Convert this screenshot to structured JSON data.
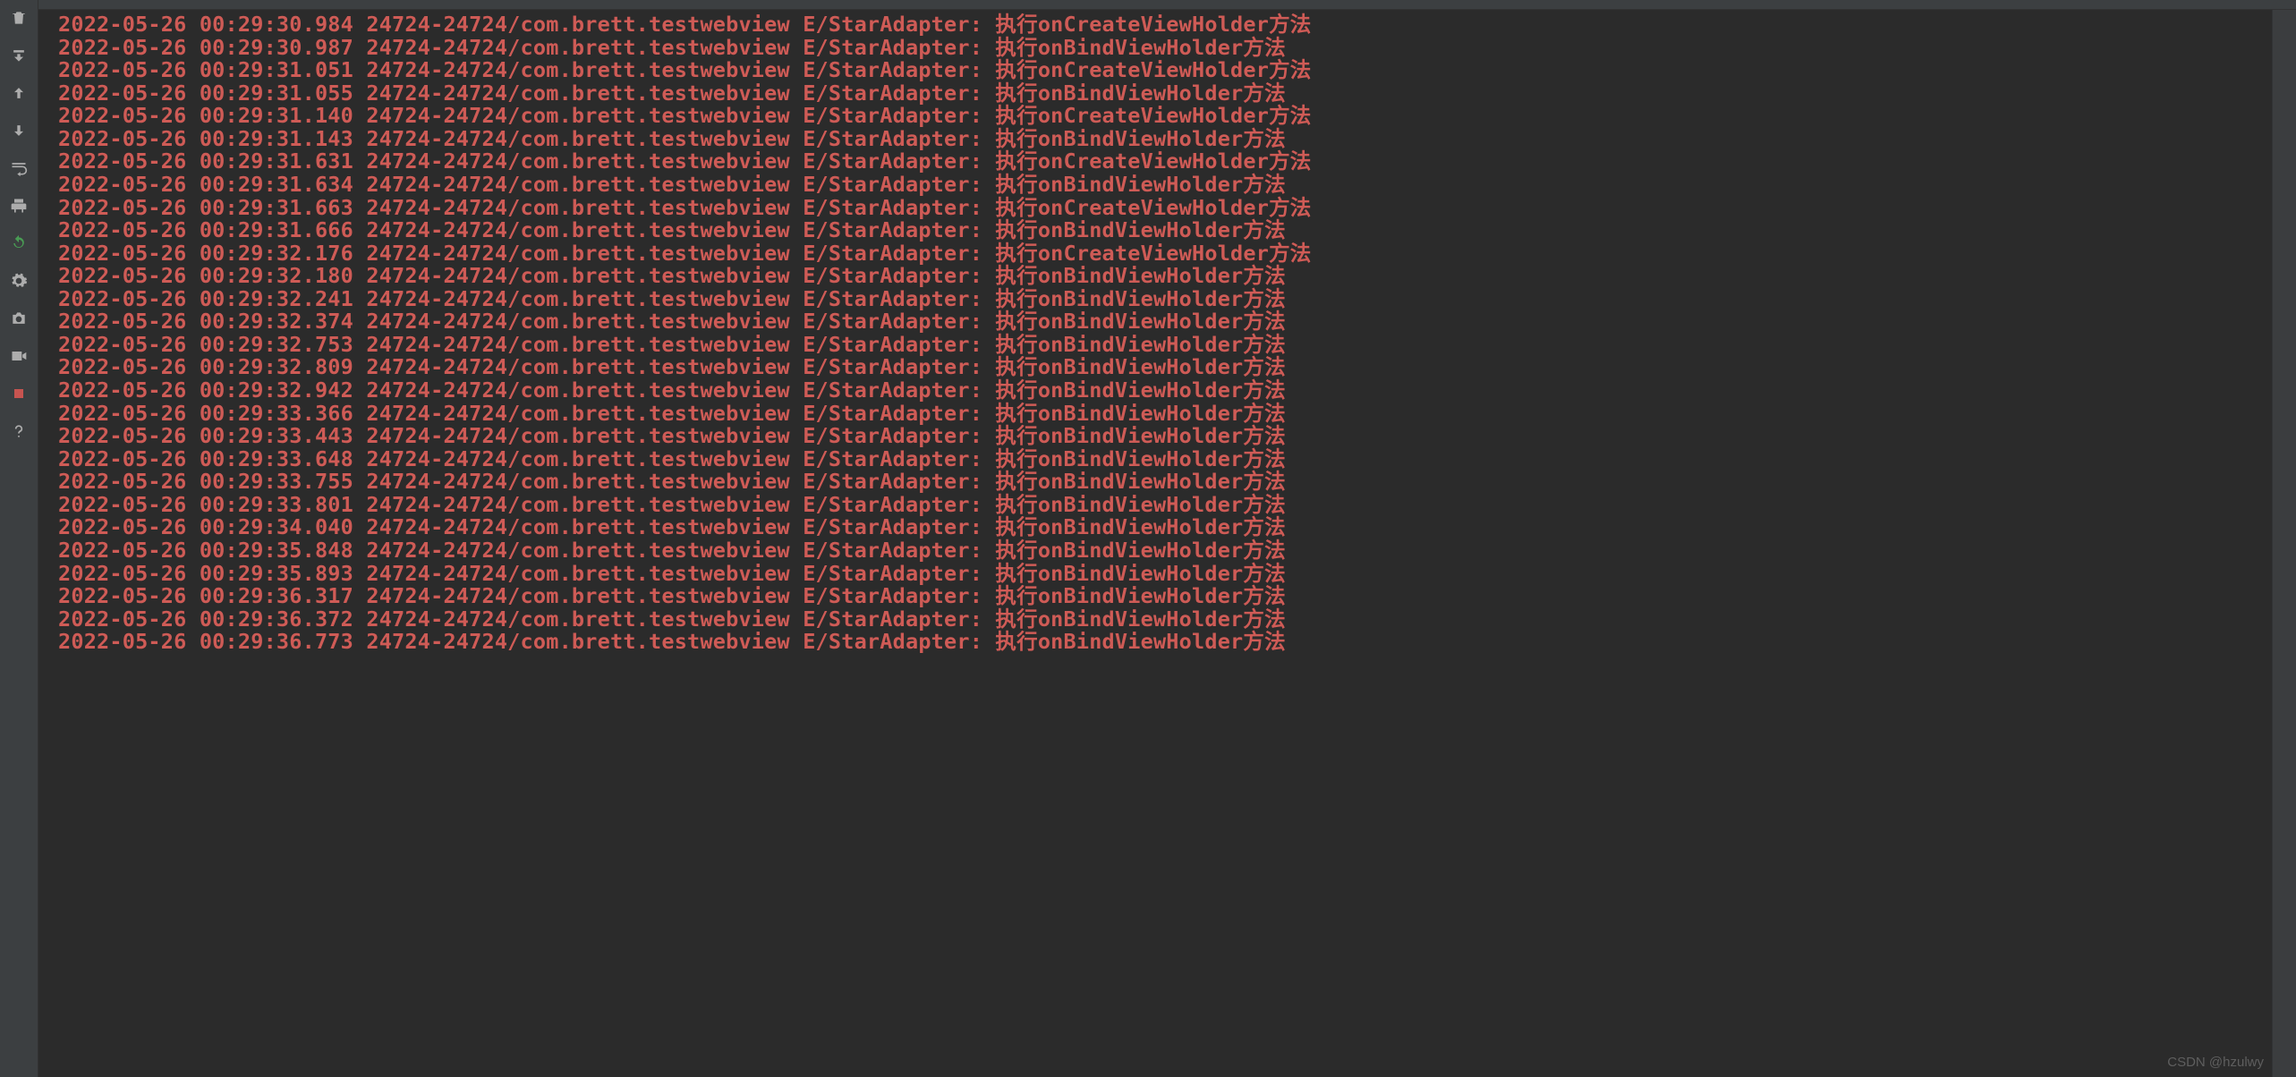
{
  "watermark": "CSDN @hzulwy",
  "gutter": {
    "items": [
      {
        "name": "trash-icon",
        "type": "trash",
        "interact": true,
        "color": ""
      },
      {
        "name": "scroll-end-icon",
        "type": "scroll-end",
        "interact": true,
        "color": ""
      },
      {
        "name": "arrow-up-icon",
        "type": "arrow-up",
        "interact": true,
        "color": ""
      },
      {
        "name": "arrow-down-icon",
        "type": "arrow-down",
        "interact": true,
        "color": ""
      },
      {
        "name": "softwrap-icon",
        "type": "softwrap",
        "interact": true,
        "color": ""
      },
      {
        "name": "printer-icon",
        "type": "printer",
        "interact": true,
        "color": ""
      },
      {
        "name": "restart-icon",
        "type": "restart",
        "interact": true,
        "color": "green"
      },
      {
        "name": "settings-icon",
        "type": "gear",
        "interact": true,
        "color": ""
      },
      {
        "name": "screenshot-icon",
        "type": "camera",
        "interact": true,
        "color": ""
      },
      {
        "name": "screen-record-icon",
        "type": "video",
        "interact": true,
        "color": ""
      },
      {
        "name": "stop-icon",
        "type": "stop",
        "interact": true,
        "color": "red"
      },
      {
        "name": "help-icon",
        "type": "help",
        "interact": true,
        "color": ""
      }
    ]
  },
  "log": {
    "date": "2022-05-26",
    "process": "24724-24724/com.brett.testwebview",
    "tag": "E/StarAdapter:",
    "lines": [
      {
        "time": "00:29:30.984",
        "msg": "执行onCreateViewHolder方法"
      },
      {
        "time": "00:29:30.987",
        "msg": "执行onBindViewHolder方法"
      },
      {
        "time": "00:29:31.051",
        "msg": "执行onCreateViewHolder方法"
      },
      {
        "time": "00:29:31.055",
        "msg": "执行onBindViewHolder方法"
      },
      {
        "time": "00:29:31.140",
        "msg": "执行onCreateViewHolder方法"
      },
      {
        "time": "00:29:31.143",
        "msg": "执行onBindViewHolder方法"
      },
      {
        "time": "00:29:31.631",
        "msg": "执行onCreateViewHolder方法"
      },
      {
        "time": "00:29:31.634",
        "msg": "执行onBindViewHolder方法"
      },
      {
        "time": "00:29:31.663",
        "msg": "执行onCreateViewHolder方法"
      },
      {
        "time": "00:29:31.666",
        "msg": "执行onBindViewHolder方法"
      },
      {
        "time": "00:29:32.176",
        "msg": "执行onCreateViewHolder方法"
      },
      {
        "time": "00:29:32.180",
        "msg": "执行onBindViewHolder方法"
      },
      {
        "time": "00:29:32.241",
        "msg": "执行onBindViewHolder方法"
      },
      {
        "time": "00:29:32.374",
        "msg": "执行onBindViewHolder方法"
      },
      {
        "time": "00:29:32.753",
        "msg": "执行onBindViewHolder方法"
      },
      {
        "time": "00:29:32.809",
        "msg": "执行onBindViewHolder方法"
      },
      {
        "time": "00:29:32.942",
        "msg": "执行onBindViewHolder方法"
      },
      {
        "time": "00:29:33.366",
        "msg": "执行onBindViewHolder方法"
      },
      {
        "time": "00:29:33.443",
        "msg": "执行onBindViewHolder方法"
      },
      {
        "time": "00:29:33.648",
        "msg": "执行onBindViewHolder方法"
      },
      {
        "time": "00:29:33.755",
        "msg": "执行onBindViewHolder方法"
      },
      {
        "time": "00:29:33.801",
        "msg": "执行onBindViewHolder方法"
      },
      {
        "time": "00:29:34.040",
        "msg": "执行onBindViewHolder方法"
      },
      {
        "time": "00:29:35.848",
        "msg": "执行onBindViewHolder方法"
      },
      {
        "time": "00:29:35.893",
        "msg": "执行onBindViewHolder方法"
      },
      {
        "time": "00:29:36.317",
        "msg": "执行onBindViewHolder方法"
      },
      {
        "time": "00:29:36.372",
        "msg": "执行onBindViewHolder方法"
      },
      {
        "time": "00:29:36.773",
        "msg": "执行onBindViewHolder方法"
      }
    ]
  }
}
